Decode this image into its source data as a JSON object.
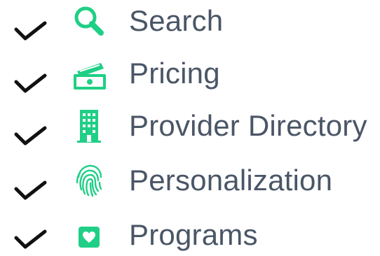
{
  "colors": {
    "icon_accent": "#1fcf85",
    "label_text": "#4a5666",
    "check": "#111111"
  },
  "features": [
    {
      "label": "Search",
      "icon": "magnifier-icon",
      "checked": true
    },
    {
      "label": "Pricing",
      "icon": "banknote-icon",
      "checked": true
    },
    {
      "label": "Provider Directory",
      "icon": "building-icon",
      "checked": true
    },
    {
      "label": "Personalization",
      "icon": "fingerprint-icon",
      "checked": true
    },
    {
      "label": "Programs",
      "icon": "heart-box-icon",
      "checked": true
    }
  ]
}
